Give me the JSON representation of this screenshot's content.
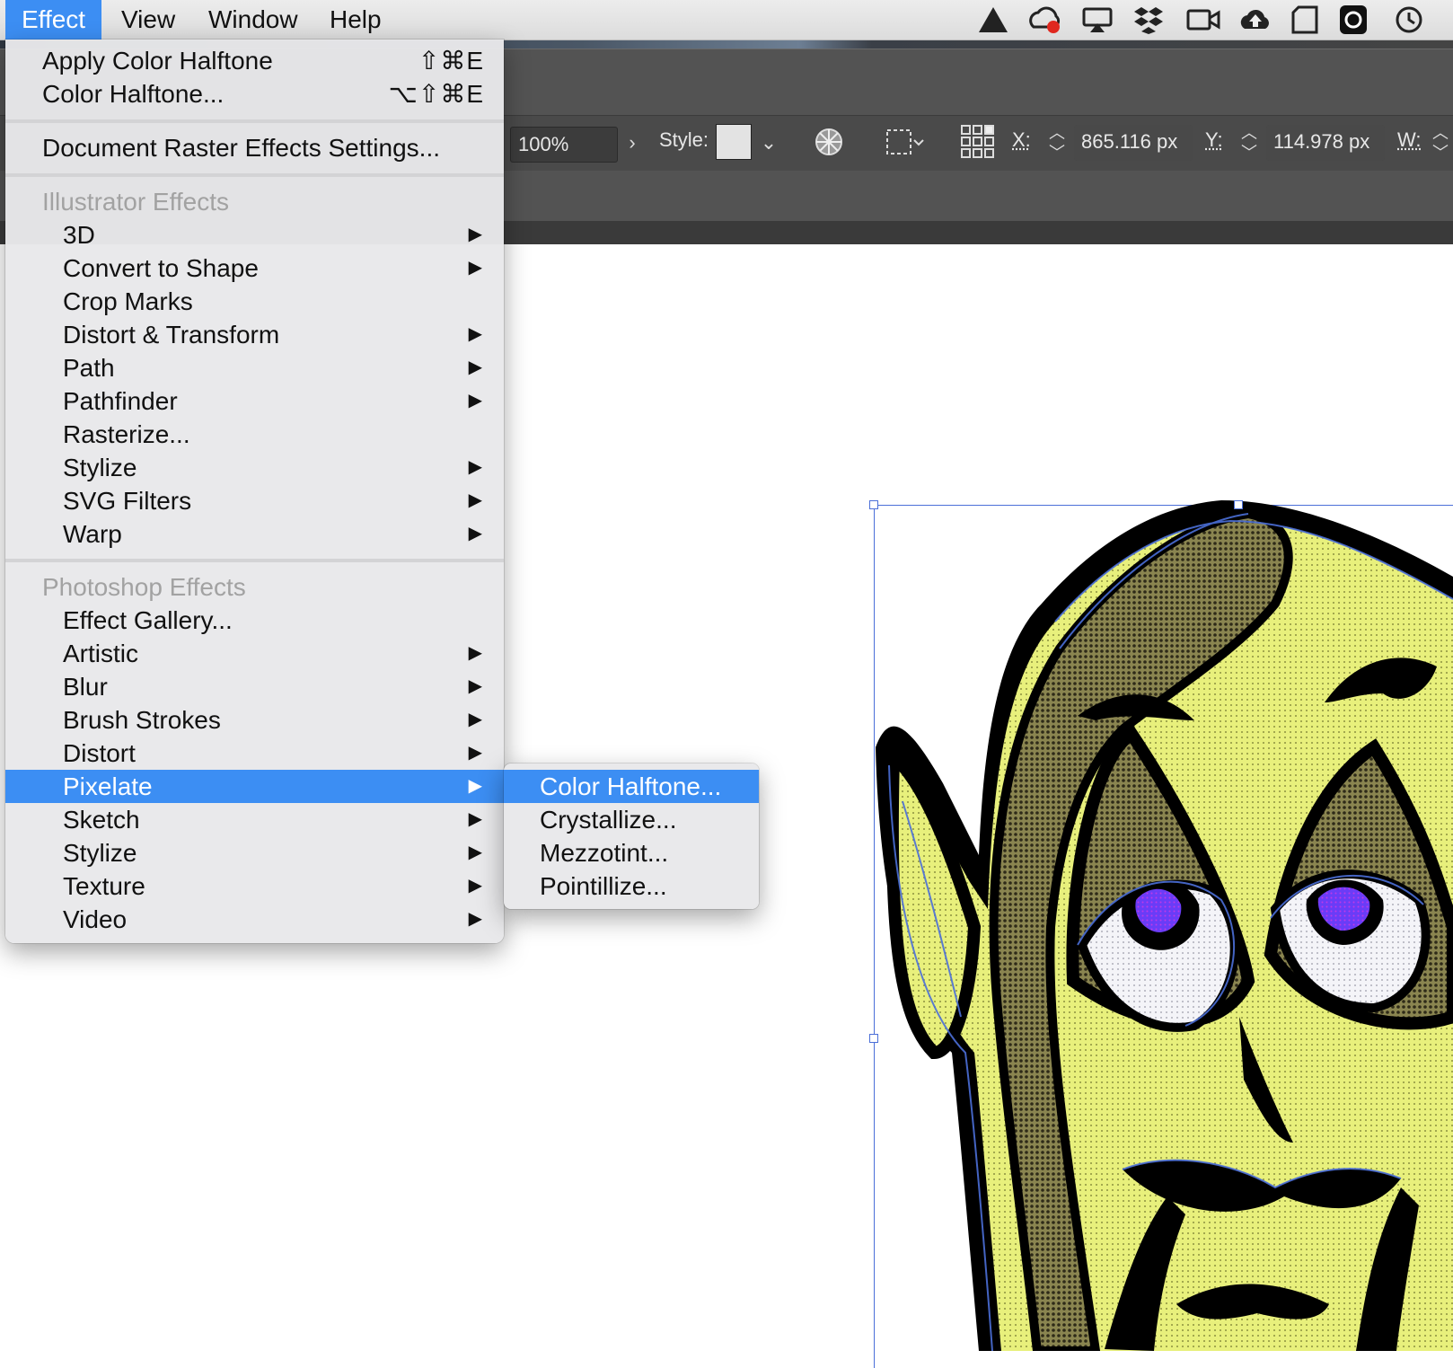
{
  "menubar": {
    "items": [
      {
        "label": "Effect"
      },
      {
        "label": "View"
      },
      {
        "label": "Window"
      },
      {
        "label": "Help"
      }
    ],
    "status_icons": [
      "google-drive-icon",
      "creative-cloud-icon",
      "airplay-icon",
      "dropbox-icon",
      "facetime-icon",
      "cloud-upload-icon",
      "sd-card-icon",
      "app-icon",
      "time-machine-icon"
    ]
  },
  "control_bar": {
    "opacity": "100%",
    "style_label": "Style:",
    "x_label": "X:",
    "x_value": "865.116 px",
    "y_label": "Y:",
    "y_value": "114.978 px",
    "w_label": "W:"
  },
  "effect_menu": {
    "apply_last": {
      "label": "Apply Color Halftone",
      "shortcut": "⇧⌘E"
    },
    "last_effect": {
      "label": "Color Halftone...",
      "shortcut": "⌥⇧⌘E"
    },
    "doc_raster": {
      "label": "Document Raster Effects Settings..."
    },
    "illustrator_header": "Illustrator Effects",
    "illustrator_items": [
      {
        "label": "3D",
        "arrow": "▶"
      },
      {
        "label": "Convert to Shape",
        "arrow": "▶"
      },
      {
        "label": "Crop Marks",
        "arrow": ""
      },
      {
        "label": "Distort & Transform",
        "arrow": "▶"
      },
      {
        "label": "Path",
        "arrow": "▶"
      },
      {
        "label": "Pathfinder",
        "arrow": "▶"
      },
      {
        "label": "Rasterize...",
        "arrow": ""
      },
      {
        "label": "Stylize",
        "arrow": "▶"
      },
      {
        "label": "SVG Filters",
        "arrow": "▶"
      },
      {
        "label": "Warp",
        "arrow": "▶"
      }
    ],
    "photoshop_header": "Photoshop Effects",
    "photoshop_items": [
      {
        "label": "Effect Gallery...",
        "arrow": ""
      },
      {
        "label": "Artistic",
        "arrow": "▶"
      },
      {
        "label": "Blur",
        "arrow": "▶"
      },
      {
        "label": "Brush Strokes",
        "arrow": "▶"
      },
      {
        "label": "Distort",
        "arrow": "▶"
      },
      {
        "label": "Pixelate",
        "arrow": "▶"
      },
      {
        "label": "Sketch",
        "arrow": "▶"
      },
      {
        "label": "Stylize",
        "arrow": "▶"
      },
      {
        "label": "Texture",
        "arrow": "▶"
      },
      {
        "label": "Video",
        "arrow": "▶"
      }
    ]
  },
  "pixelate_submenu": {
    "items": [
      {
        "label": "Color Halftone..."
      },
      {
        "label": "Crystallize..."
      },
      {
        "label": "Mezzotint..."
      },
      {
        "label": "Pointillize..."
      }
    ]
  },
  "colors": {
    "accent": "#3c8ef3",
    "face_fill": "#e4ef7a",
    "hair_fill": "#6e6a3a",
    "iris": "#5b2bf5",
    "selection": "#4b6fd8"
  }
}
